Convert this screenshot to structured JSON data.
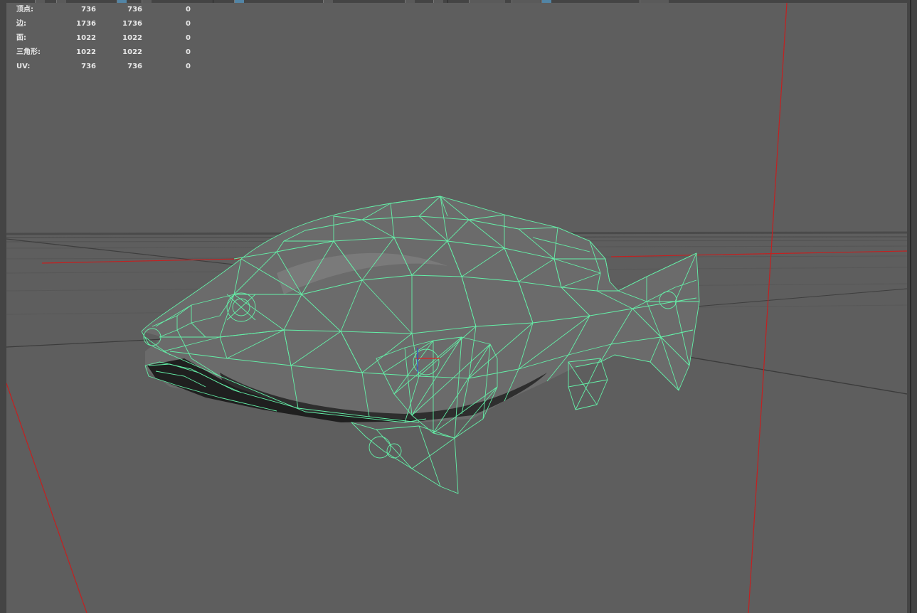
{
  "hud": {
    "rows": [
      {
        "label": "顶点:",
        "v1": "736",
        "v2": "736",
        "v3": "0"
      },
      {
        "label": "边:",
        "v1": "1736",
        "v2": "1736",
        "v3": "0"
      },
      {
        "label": "面:",
        "v1": "1022",
        "v2": "1022",
        "v3": "0"
      },
      {
        "label": "三角形:",
        "v1": "1022",
        "v2": "1022",
        "v3": "0"
      },
      {
        "label": "UV:",
        "v1": "736",
        "v2": "736",
        "v3": "0"
      }
    ]
  },
  "colors": {
    "viewport_bg": "#5e5e5e",
    "wireframe": "#64f0a8",
    "axis_red": "#c42020",
    "grid": "#474747",
    "hud_text": "#e8e8e8"
  },
  "icons": [
    "select-tool-icon",
    "snap-icon",
    "camera-icon",
    "grid-toggle-icon",
    "isolate-select-icon"
  ]
}
